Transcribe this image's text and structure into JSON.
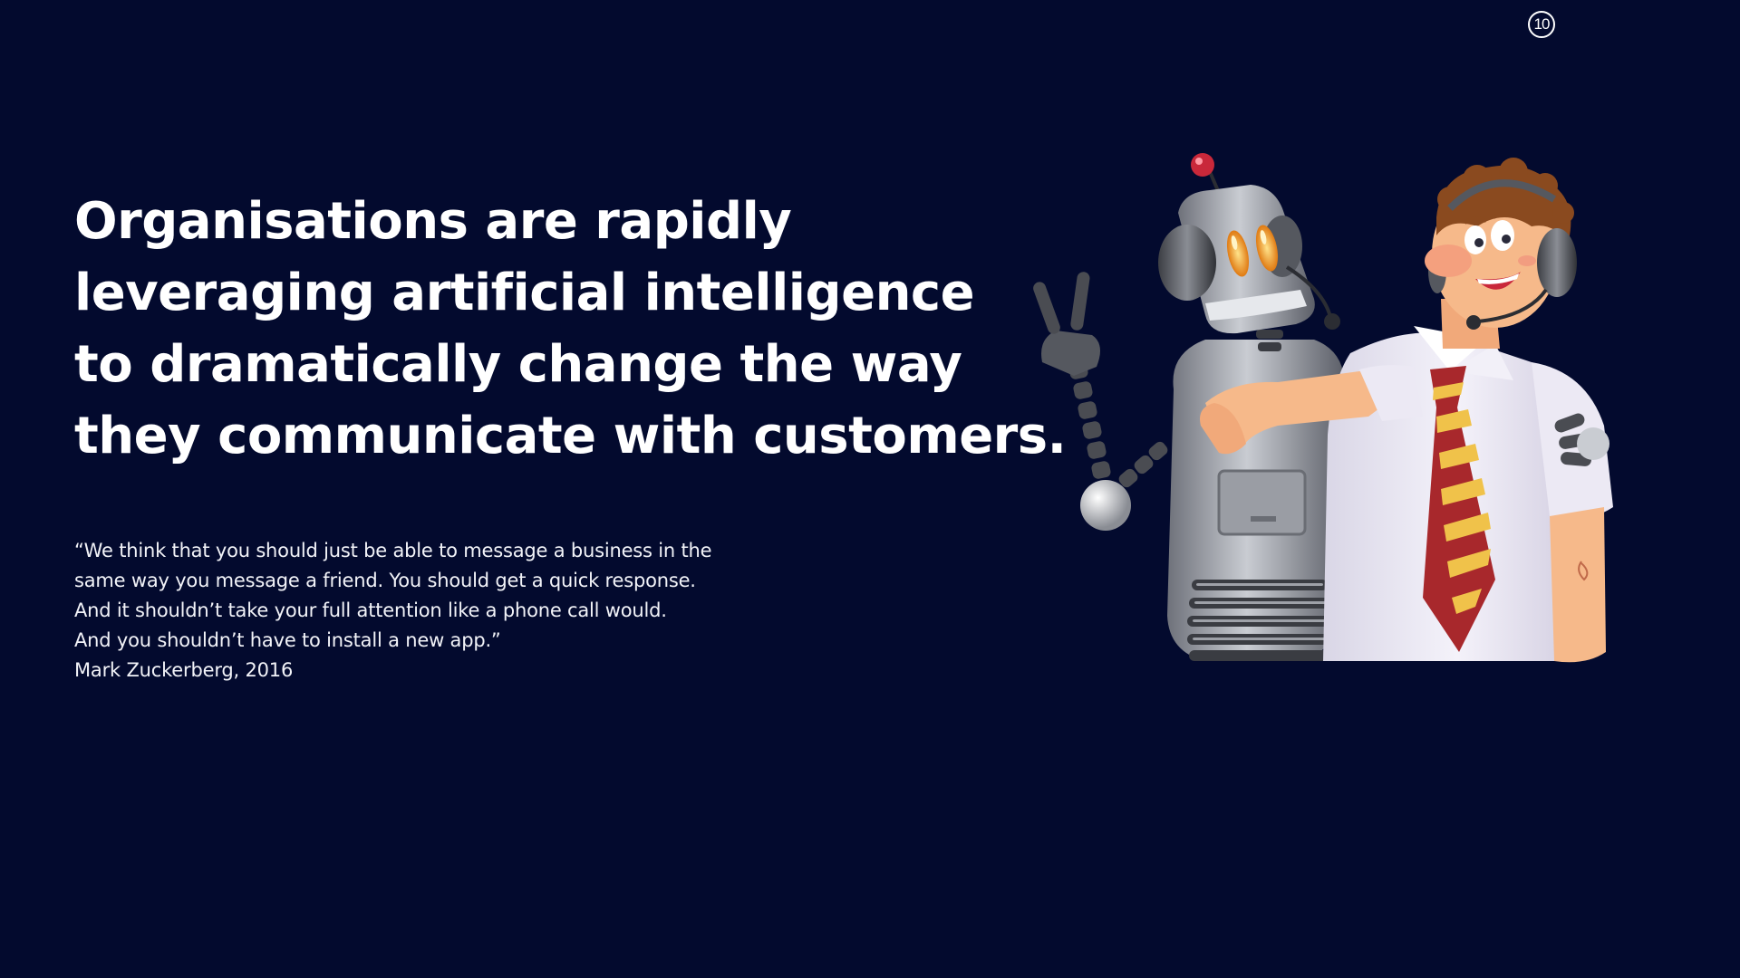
{
  "page_number": "10",
  "headline": {
    "lines": [
      "Organisations are rapidly",
      "leveraging artificial intelligence",
      "to dramatically change the way",
      "they communicate with customers."
    ]
  },
  "quote": {
    "lines": [
      "“We think that you should just be able to message a business in the",
      "same way you message a friend. You should get a quick response.",
      "And it shouldn’t take your full attention like a phone call would.",
      "And you shouldn’t have to install a new app.”"
    ],
    "attribution": "Mark Zuckerberg, 2016"
  },
  "colors": {
    "background": "#030a2e",
    "text": "#ffffff",
    "tie_red": "#a8282c",
    "tie_yellow": "#f0c24a",
    "robot_grey": "#8c8f96"
  },
  "illustration": {
    "icon": "robot-and-support-agent-illustration"
  }
}
